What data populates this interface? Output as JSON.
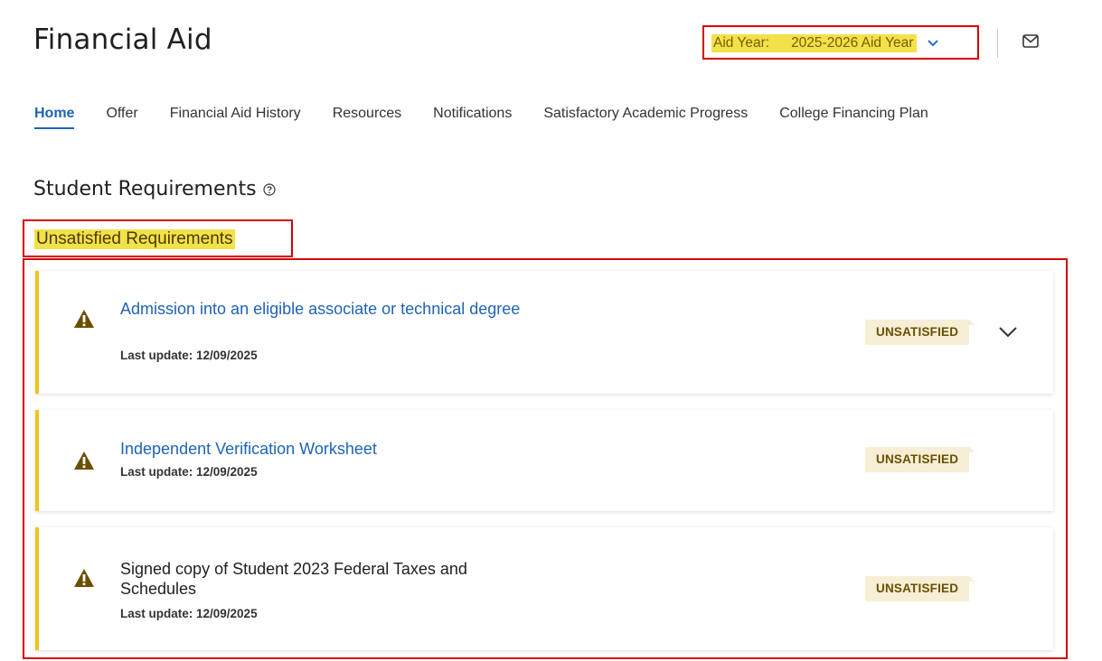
{
  "header": {
    "title": "Financial Aid",
    "aid_year": {
      "label": "Aid Year:",
      "value": "2025-2026 Aid Year"
    }
  },
  "nav": {
    "items": [
      {
        "label": "Home",
        "active": true
      },
      {
        "label": "Offer"
      },
      {
        "label": "Financial Aid History"
      },
      {
        "label": "Resources"
      },
      {
        "label": "Notifications"
      },
      {
        "label": "Satisfactory Academic Progress"
      },
      {
        "label": "College Financing Plan"
      }
    ]
  },
  "requirements": {
    "heading": "Student Requirements",
    "subheading": "Unsatisfied Requirements",
    "items": [
      {
        "title": "Admission into an eligible associate or technical degree",
        "last_update": "Last update: 12/09/2025",
        "status": "UNSATISFIED",
        "icon": "warning-icon"
      },
      {
        "title": "Independent Verification Worksheet",
        "last_update": "Last update: 12/09/2025",
        "status": "UNSATISFIED",
        "icon": "warning-icon"
      },
      {
        "title": "Signed copy of Student 2023 Federal Taxes and Schedules",
        "last_update": "Last update: 12/09/2025",
        "status": "UNSATISFIED",
        "icon": "warning-icon"
      }
    ]
  },
  "colors": {
    "link": "#1e63b7",
    "highlight": "#f3e14a",
    "annotation": "#d40000",
    "card_accent": "#f0c419",
    "badge_bg": "#f6efd6",
    "badge_text": "#6b4e00",
    "warning_icon": "#6b4e00"
  }
}
